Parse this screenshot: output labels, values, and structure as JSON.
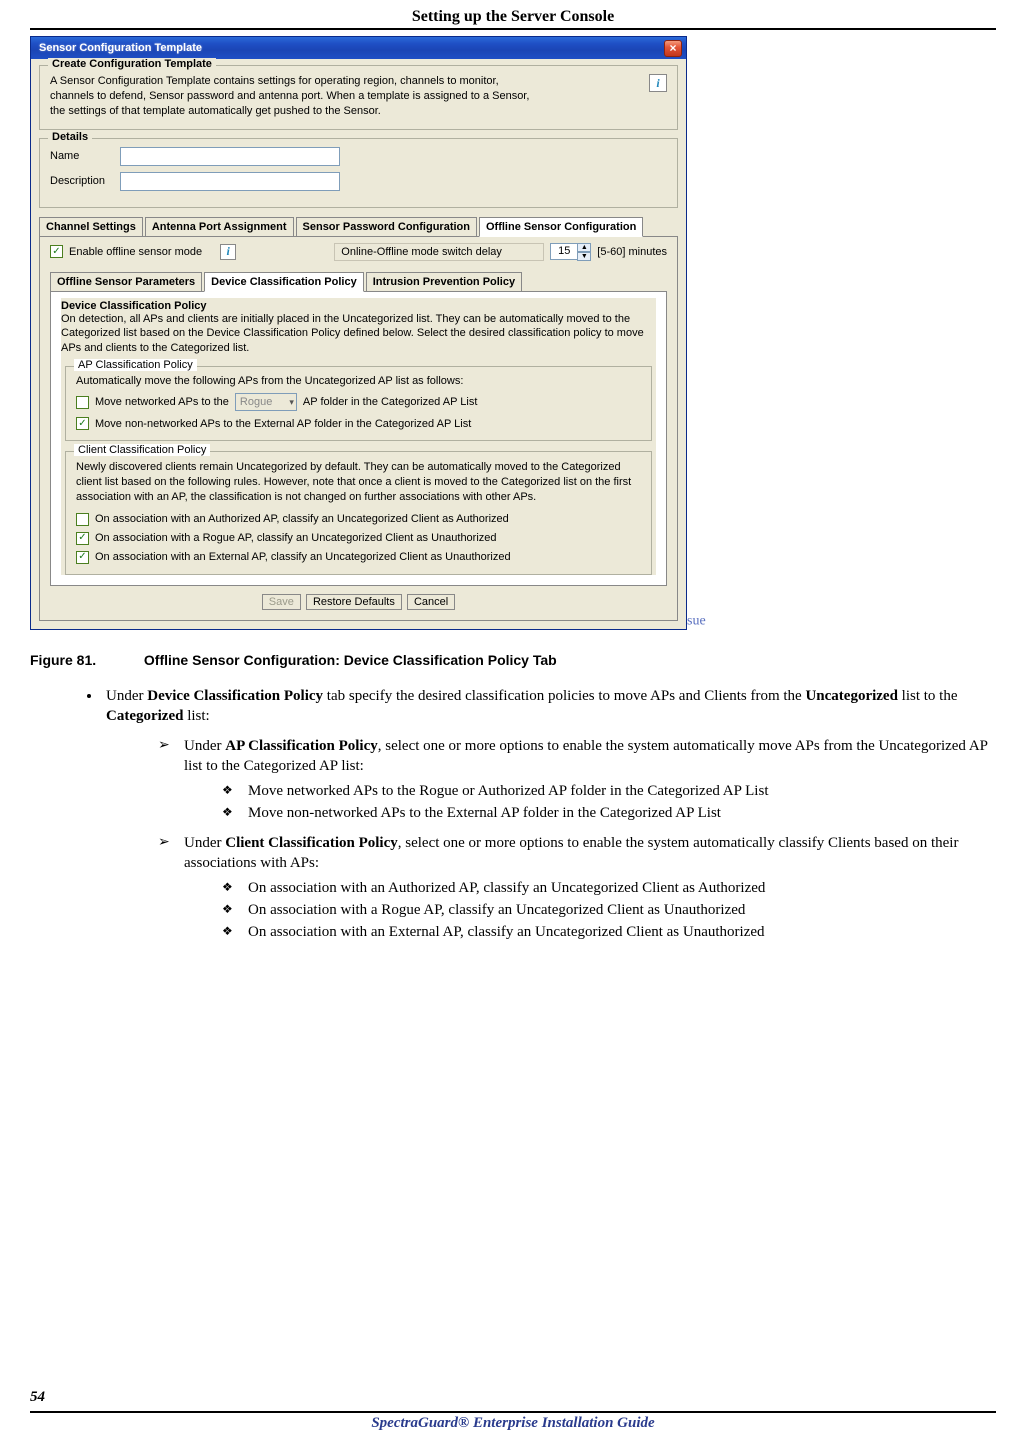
{
  "page": {
    "header": "Setting up the Server Console",
    "number": "54",
    "footer": "SpectraGuard® Enterprise Installation Guide",
    "sue_text": "sue"
  },
  "dialog": {
    "title": "Sensor Configuration Template",
    "create_group": {
      "legend": "Create Configuration Template",
      "intro": "A Sensor Configuration Template contains settings for operating region, channels to monitor, channels to defend, Sensor password and antenna port. When a template is assigned to a Sensor, the settings of that template automatically get pushed to the Sensor."
    },
    "details": {
      "legend": "Details",
      "name_label": "Name",
      "name_value": "",
      "desc_label": "Description",
      "desc_value": ""
    },
    "tabs": [
      "Channel Settings",
      "Antenna Port Assignment",
      "Sensor Password Configuration",
      "Offline Sensor Configuration"
    ],
    "active_tab": 3,
    "offline": {
      "enable_label": "Enable offline sensor mode",
      "enable_checked": true,
      "switch_label": "Online-Offline mode switch delay",
      "switch_value": "15",
      "switch_range": "[5-60] minutes"
    },
    "subtabs": [
      "Offline Sensor Parameters",
      "Device Classification Policy",
      "Intrusion Prevention Policy"
    ],
    "active_subtab": 1,
    "dcp": {
      "legend": "Device Classification Policy",
      "intro": "On detection, all APs and clients are initially placed in the Uncategorized list. They can be automatically moved to the Categorized list based on the Device Classification Policy defined below. Select the desired classification policy to move APs and clients to the Categorized list.",
      "ap_group": {
        "legend": "AP Classification Policy",
        "intro": "Automatically move the following APs from the Uncategorized AP list as follows:",
        "opt1_pre": "Move networked APs to the",
        "opt1_sel": "Rogue",
        "opt1_post": "AP folder in the Categorized AP List",
        "opt1_checked": false,
        "opt2": "Move non-networked APs to the External AP folder in the Categorized AP List",
        "opt2_checked": true
      },
      "client_group": {
        "legend": "Client Classification Policy",
        "intro": "Newly discovered clients remain Uncategorized by default. They can be automatically moved to the Categorized client list based on the following rules. However, note that once a client is moved to the Categorized list on the first association with an AP, the classification is not changed on further associations with other APs.",
        "opt1": "On association with an Authorized AP, classify an Uncategorized Client as Authorized",
        "opt1_checked": false,
        "opt2": "On association with a Rogue AP, classify an Uncategorized Client as Unauthorized",
        "opt2_checked": true,
        "opt3": "On association with an External AP, classify an Uncategorized Client as Unauthorized",
        "opt3_checked": true
      }
    },
    "buttons": {
      "save": "Save",
      "restore": "Restore Defaults",
      "cancel": "Cancel"
    }
  },
  "figure": {
    "label": "Figure  81.",
    "caption": "Offline Sensor Configuration: Device Classification Policy Tab"
  },
  "body": {
    "l1_pre": "Under ",
    "l1_b1": "Device Classification Policy",
    "l1_mid1": " tab specify the desired classification policies to move APs and Clients from the ",
    "l1_b2": "Uncategorized",
    "l1_mid2": " list to the ",
    "l1_b3": "Categorized",
    "l1_post": " list:",
    "l2a_pre": "Under ",
    "l2a_b": "AP Classification Policy",
    "l2a_post": ", select one or more options to enable the system automatically move APs from the Uncategorized AP list to the Categorized AP list:",
    "l3a1": "Move networked APs to the Rogue or Authorized AP folder in the Categorized AP List",
    "l3a2": "Move non-networked APs to the External AP folder in the Categorized AP List",
    "l2b_pre": "Under ",
    "l2b_b": "Client Classification Policy",
    "l2b_post": ", select one or more options to enable the system automatically classify Clients based on their associations with APs:",
    "l3b1": "On association with an Authorized AP, classify an Uncategorized Client as Authorized",
    "l3b2": "On association with a Rogue AP, classify an Uncategorized Client as Unauthorized",
    "l3b3": "On association with an External AP, classify an Uncategorized Client as Unauthorized"
  }
}
